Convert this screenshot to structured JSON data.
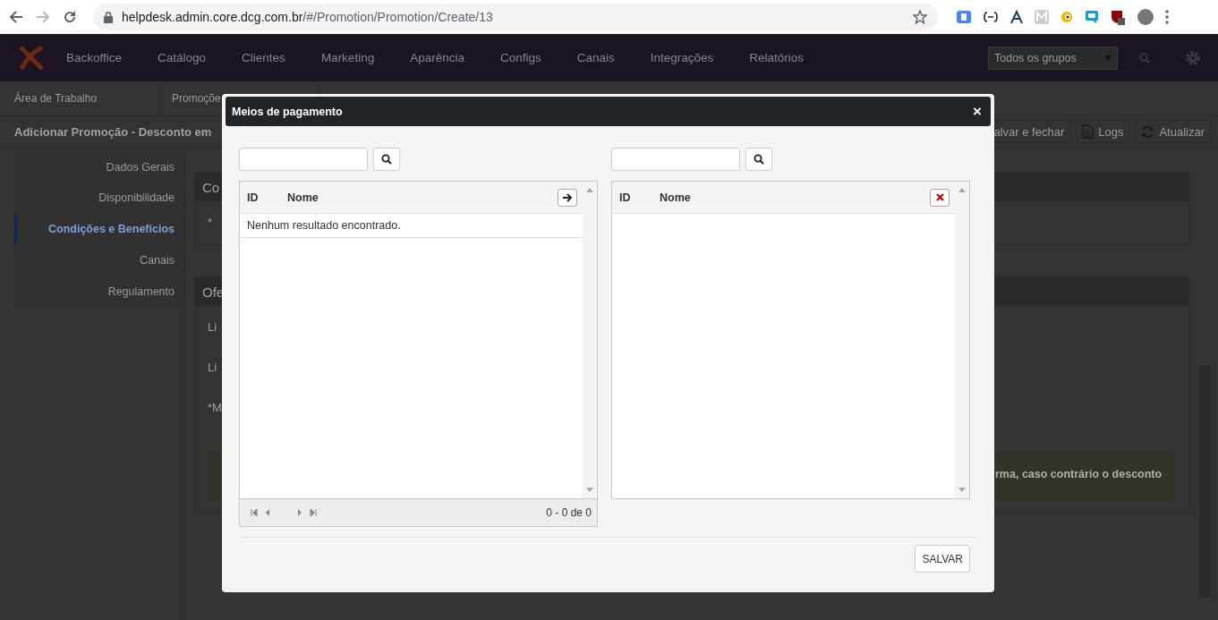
{
  "browser": {
    "url_host": "helpdesk.admin.core.dcg.com.br",
    "url_path": "/#/Promotion/Promotion/Create/13"
  },
  "nav": {
    "brand": "Backoffice",
    "items": [
      "Catálogo",
      "Clientes",
      "Marketing",
      "Aparência",
      "Configs",
      "Canais",
      "Integrações",
      "Relatórios"
    ],
    "group_select": "Todos os grupos"
  },
  "tabs": [
    "Área de Trabalho",
    "Promoçõe"
  ],
  "page": {
    "title": "Adicionar Promoção - Desconto em",
    "buttons": [
      {
        "kind": "save",
        "label": "alvar e fechar"
      },
      {
        "kind": "logs",
        "label": "Logs"
      },
      {
        "kind": "refresh",
        "label": "Atualizar"
      }
    ]
  },
  "sidebar": [
    {
      "label": "Dados Gerais",
      "selected": false
    },
    {
      "label": "Disponibilidade",
      "selected": false
    },
    {
      "label": "Condições e Benefícios",
      "selected": true
    },
    {
      "label": "Canais",
      "selected": false
    },
    {
      "label": "Regulamento",
      "selected": false
    }
  ],
  "sections": [
    {
      "header": "Co",
      "lines": [
        "*"
      ]
    },
    {
      "header": "Ofe",
      "lines": [
        "Li",
        "Li",
        "*M"
      ],
      "alert": "rma, caso contrário o desconto"
    }
  ],
  "modal": {
    "title": "Meios de pagamento",
    "close": "×",
    "left": {
      "columns": [
        "ID",
        "Nome"
      ],
      "empty": "Nenhum resultado encontrado.",
      "pager": "0 - 0 de 0"
    },
    "right": {
      "columns": [
        "ID",
        "Nome"
      ]
    },
    "save": "SALVAR"
  }
}
